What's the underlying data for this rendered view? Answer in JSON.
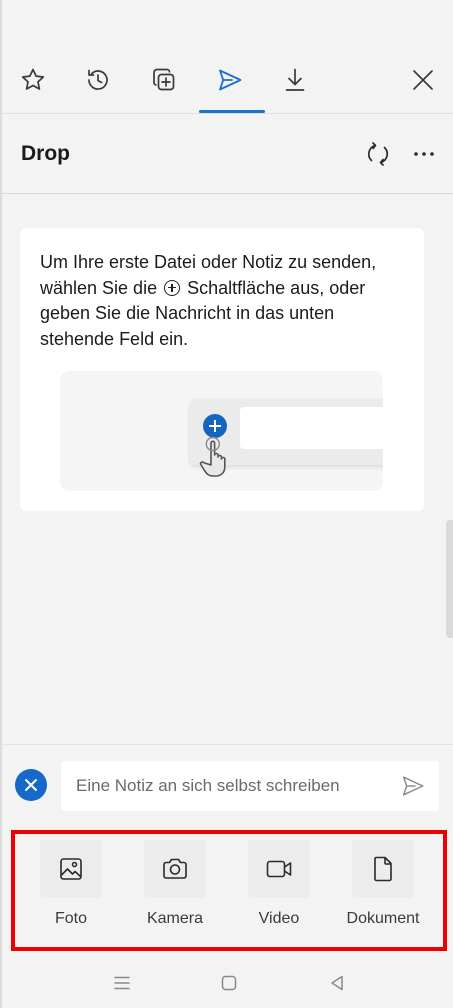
{
  "tabs": [
    {
      "name": "favorites",
      "icon": "star-icon"
    },
    {
      "name": "history",
      "icon": "history-icon"
    },
    {
      "name": "collections",
      "icon": "collections-icon"
    },
    {
      "name": "drop",
      "icon": "send-icon",
      "active": true
    },
    {
      "name": "downloads",
      "icon": "download-icon"
    }
  ],
  "close_icon": "close-icon",
  "header": {
    "title": "Drop",
    "sync_icon": "sync-icon",
    "more_icon": "more-icon"
  },
  "card": {
    "text_before": "Um Ihre erste Datei oder Notiz zu senden, wählen Sie die",
    "text_after": "Schaltfläche aus, oder geben Sie die Nachricht in das unten stehende Feld ein."
  },
  "note": {
    "placeholder": "Eine Notiz an sich selbst schreiben"
  },
  "attachments": [
    {
      "label": "Foto",
      "icon": "image-icon"
    },
    {
      "label": "Kamera",
      "icon": "camera-icon"
    },
    {
      "label": "Video",
      "icon": "video-icon"
    },
    {
      "label": "Dokument",
      "icon": "document-icon"
    }
  ],
  "colors": {
    "accent": "#1a6fd0",
    "highlight": "#ee0000"
  }
}
